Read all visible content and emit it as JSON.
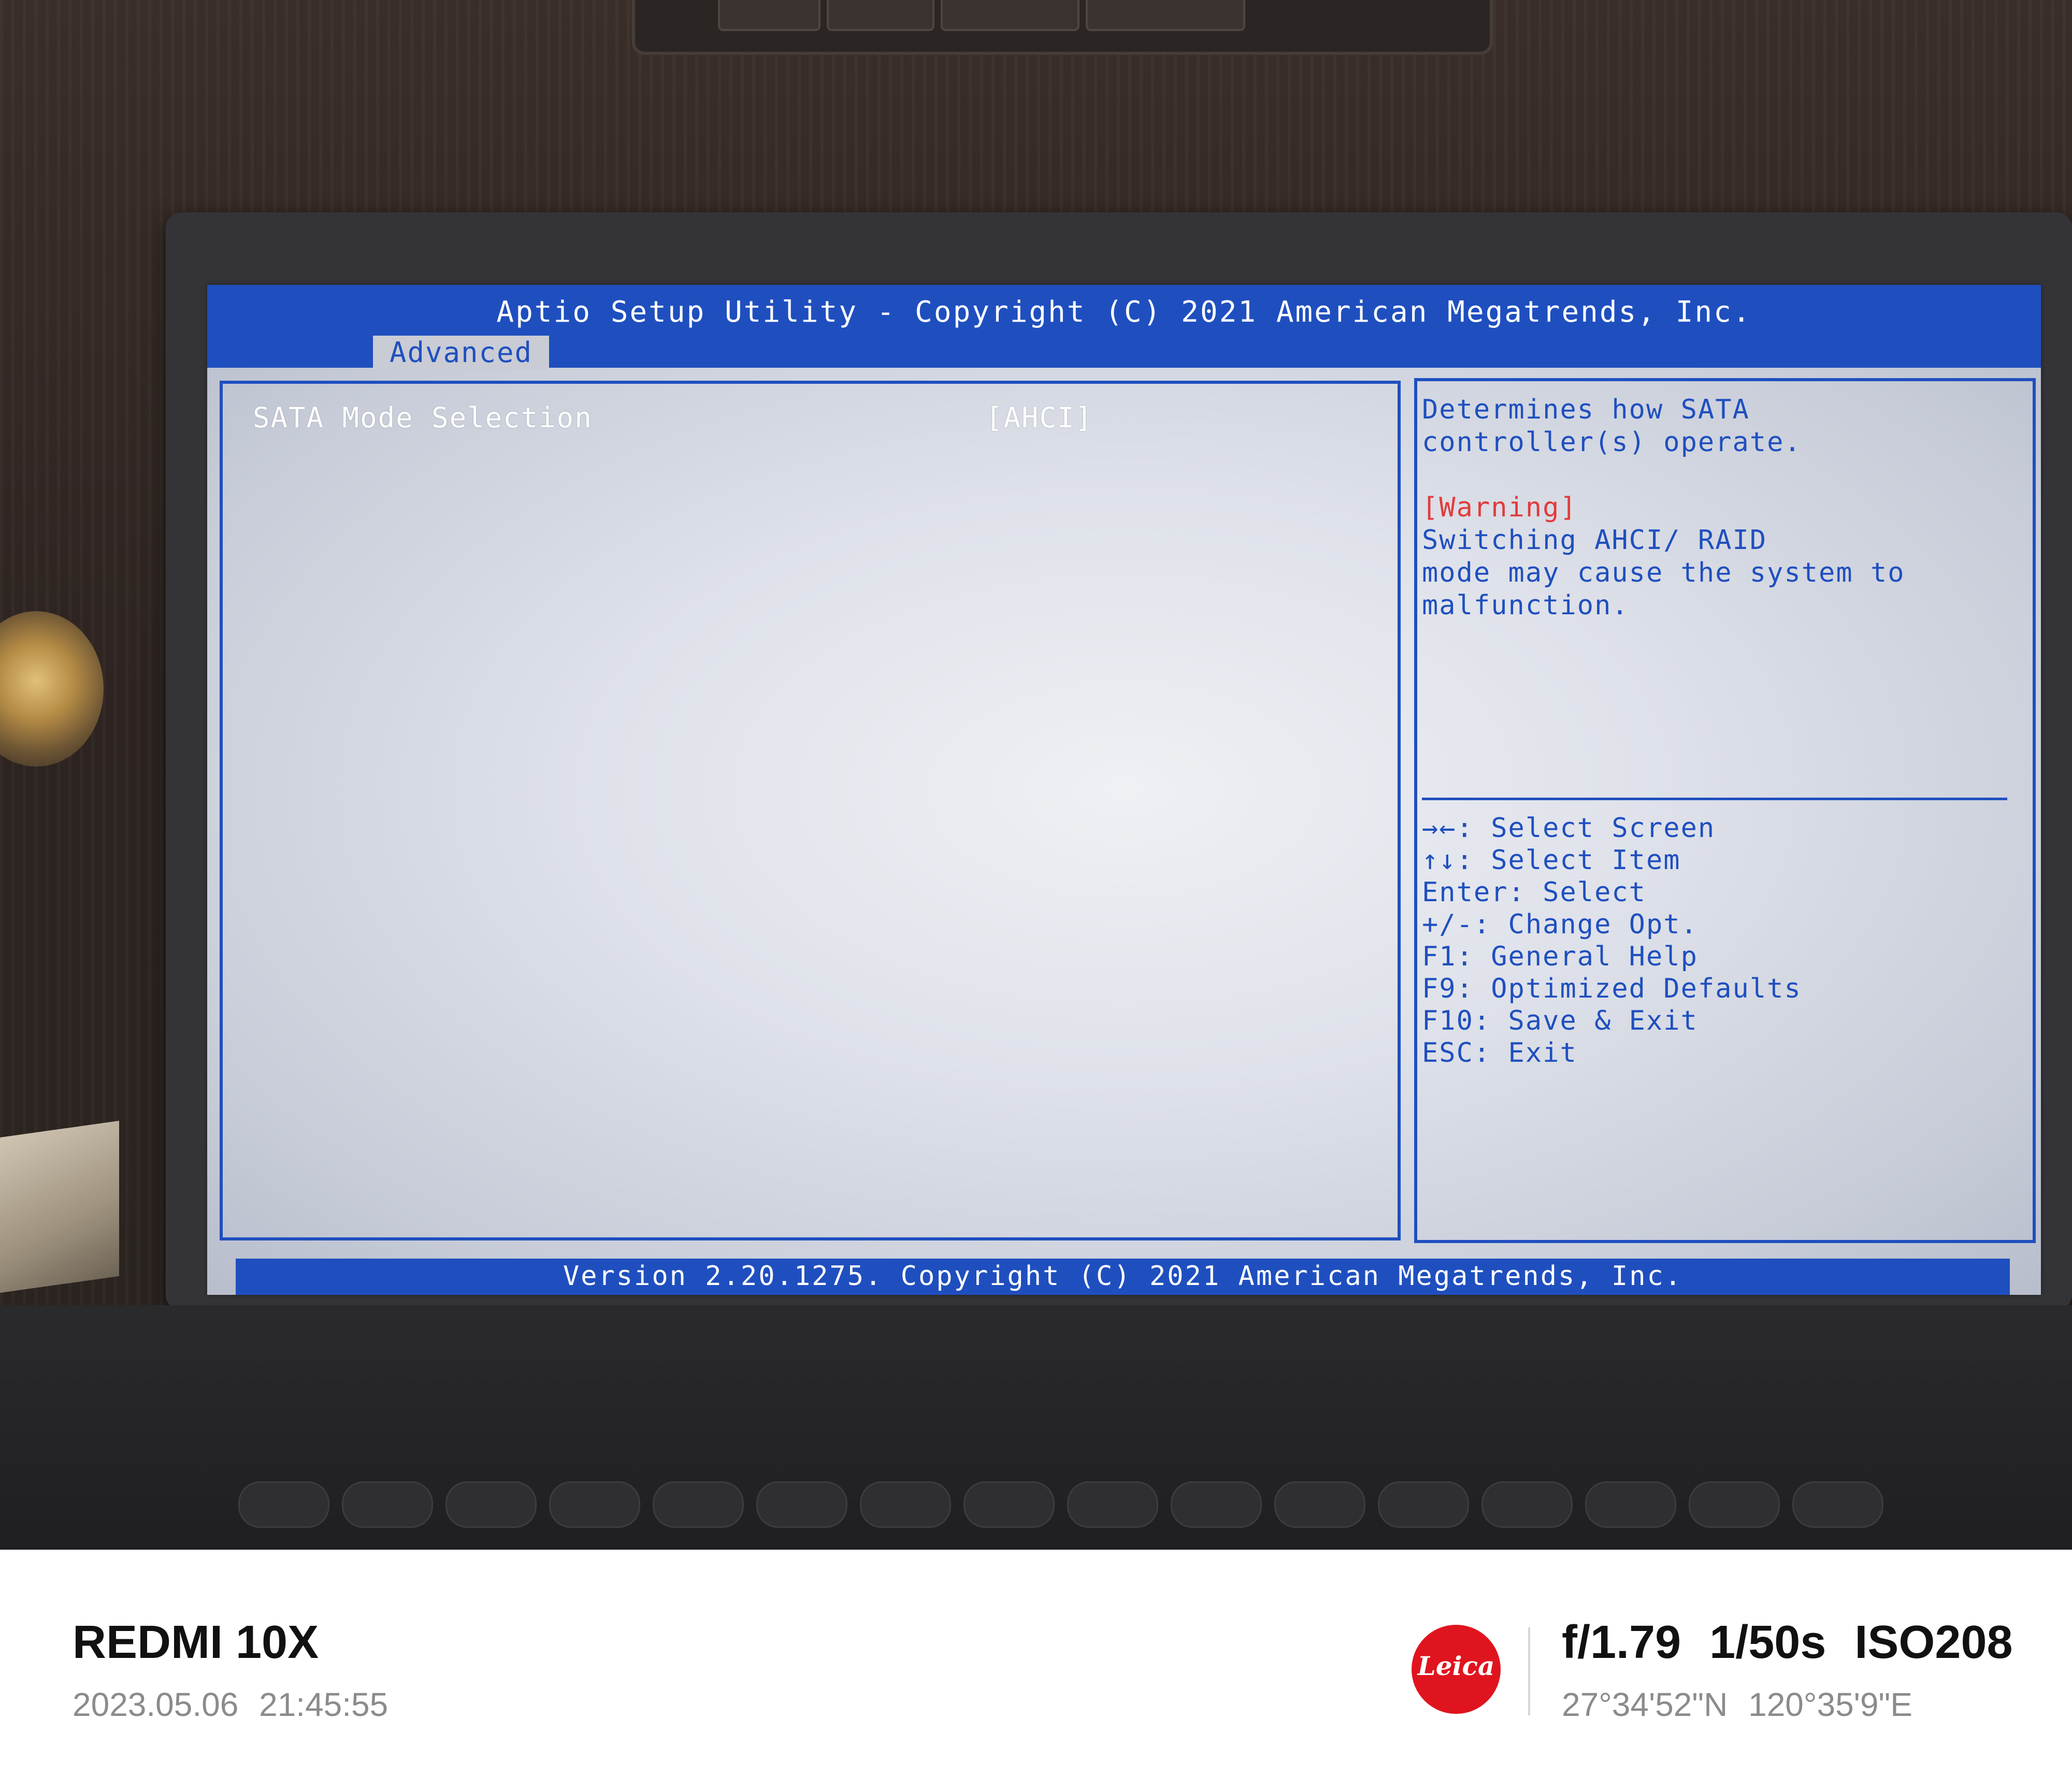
{
  "bios": {
    "header_title": "Aptio Setup Utility - Copyright (C) 2021 American Megatrends, Inc.",
    "active_tab": "Advanced",
    "settings": [
      {
        "label": "SATA Mode Selection",
        "value": "[AHCI]"
      }
    ],
    "help": {
      "description": [
        "Determines how SATA",
        "controller(s) operate."
      ],
      "warning_label": "[Warning]",
      "warning_text": [
        "Switching AHCI/ RAID",
        "mode may cause the system to",
        "malfunction."
      ]
    },
    "key_hints": [
      "→←: Select Screen",
      "↑↓: Select Item",
      "Enter: Select",
      "+/-: Change Opt.",
      "F1: General Help",
      "F9: Optimized Defaults",
      "F10: Save & Exit",
      "ESC: Exit"
    ],
    "footer_text": "Version 2.20.1275. Copyright (C) 2021 American Megatrends, Inc.",
    "colors": {
      "accent_blue": "#1f4fbf",
      "warning_red": "#e23b3b",
      "panel_bg": "#dfe2ea"
    }
  },
  "watermark": {
    "device": "REDMI 10X",
    "datetime": "2023.05.06  21:45:55",
    "brand_logo": "Leica",
    "exif": "f/1.79  1/50s  ISO208",
    "gps": "27°34'52\"N  120°35'9\"E",
    "logo_color": "#e0141e"
  }
}
